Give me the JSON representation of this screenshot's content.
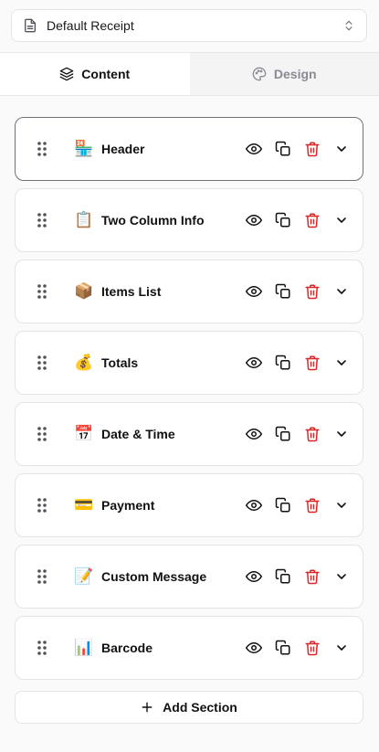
{
  "receipt_select": {
    "value": "Default Receipt",
    "icon": "document-icon"
  },
  "tabs": [
    {
      "label": "Content",
      "icon": "layers-icon",
      "active": true
    },
    {
      "label": "Design",
      "icon": "palette-icon",
      "active": false
    }
  ],
  "sections": [
    {
      "label": "Header",
      "emoji": "🏪"
    },
    {
      "label": "Two Column Info",
      "emoji": "📋"
    },
    {
      "label": "Items List",
      "emoji": "📦"
    },
    {
      "label": "Totals",
      "emoji": "💰"
    },
    {
      "label": "Date & Time",
      "emoji": "📅"
    },
    {
      "label": "Payment",
      "emoji": "💳"
    },
    {
      "label": "Custom Message",
      "emoji": "📝"
    },
    {
      "label": "Barcode",
      "emoji": "📊"
    }
  ],
  "add_section_label": "Add Section",
  "colors": {
    "delete": "#dc2626",
    "border": "#e4e4e7",
    "active_border": "#71717a"
  }
}
